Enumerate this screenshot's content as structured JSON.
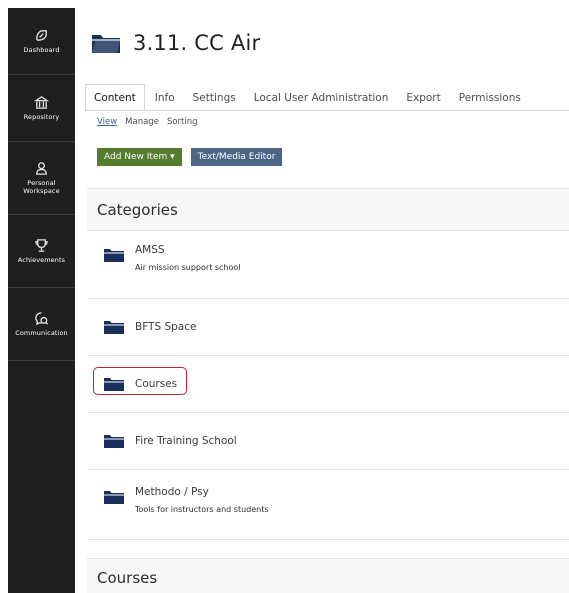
{
  "sidebar": {
    "items": [
      {
        "label": "Dashboard",
        "icon": "dashboard-icon"
      },
      {
        "label": "Repository",
        "icon": "repository-icon"
      },
      {
        "label": "Personal Workspace",
        "icon": "personal-workspace-icon"
      },
      {
        "label": "Achievements",
        "icon": "trophy-icon"
      },
      {
        "label": "Communication",
        "icon": "communication-icon"
      }
    ]
  },
  "header": {
    "title": "3.11. CC Air",
    "icon": "folder-icon"
  },
  "tabs": [
    {
      "label": "Content",
      "active": true
    },
    {
      "label": "Info"
    },
    {
      "label": "Settings"
    },
    {
      "label": "Local User Administration"
    },
    {
      "label": "Export"
    },
    {
      "label": "Permissions"
    }
  ],
  "subtabs": [
    {
      "label": "View",
      "active": true
    },
    {
      "label": "Manage"
    },
    {
      "label": "Sorting"
    }
  ],
  "toolbar": {
    "add_new_item": "Add New Item ▾",
    "text_media_editor": "Text/Media Editor"
  },
  "categories": {
    "header": "Categories",
    "items": [
      {
        "title": "AMSS",
        "description": "Air mission support school"
      },
      {
        "title": "BFTS Space",
        "description": ""
      },
      {
        "title": "Courses",
        "description": "",
        "highlighted": true
      },
      {
        "title": "Fire Training School",
        "description": ""
      },
      {
        "title": "Methodo / Psy",
        "description": "Tools for instructors and students"
      }
    ]
  },
  "courses": {
    "header": "Courses"
  },
  "colors": {
    "sidebar_bg": "#1f1f1f",
    "folder_blue": "#1a2f5c",
    "btn_green": "#557b2e",
    "btn_blue": "#4c6586",
    "highlight_red": "#c8202c",
    "link_blue": "#3a5e98"
  }
}
